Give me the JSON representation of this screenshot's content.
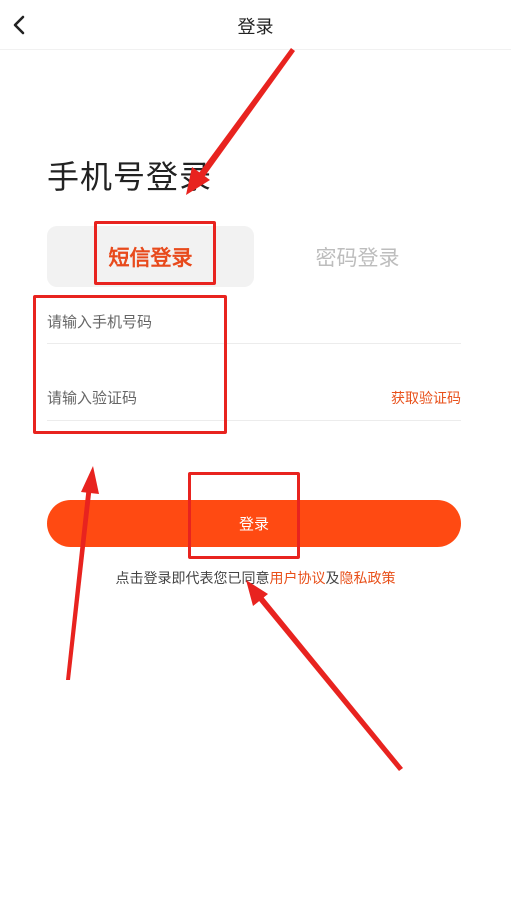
{
  "navbar": {
    "title": "登录",
    "back_icon": "chevron-left-icon"
  },
  "heading": "手机号登录",
  "tabs": [
    {
      "label": "短信登录",
      "active": true
    },
    {
      "label": "密码登录",
      "active": false
    }
  ],
  "form": {
    "phone_placeholder": "请输入手机号码",
    "phone_value": "",
    "code_placeholder": "请输入验证码",
    "code_value": "",
    "get_code_label": "获取验证码"
  },
  "login_button": "登录",
  "agreement": {
    "prefix": "点击登录即代表您已同意",
    "user_agreement": "用户协议",
    "and": "及",
    "privacy_policy": "隐私政策"
  },
  "colors": {
    "accent": "#ff4a12",
    "annotation": "#e8231f",
    "tab_active_text": "#e84a1c"
  }
}
